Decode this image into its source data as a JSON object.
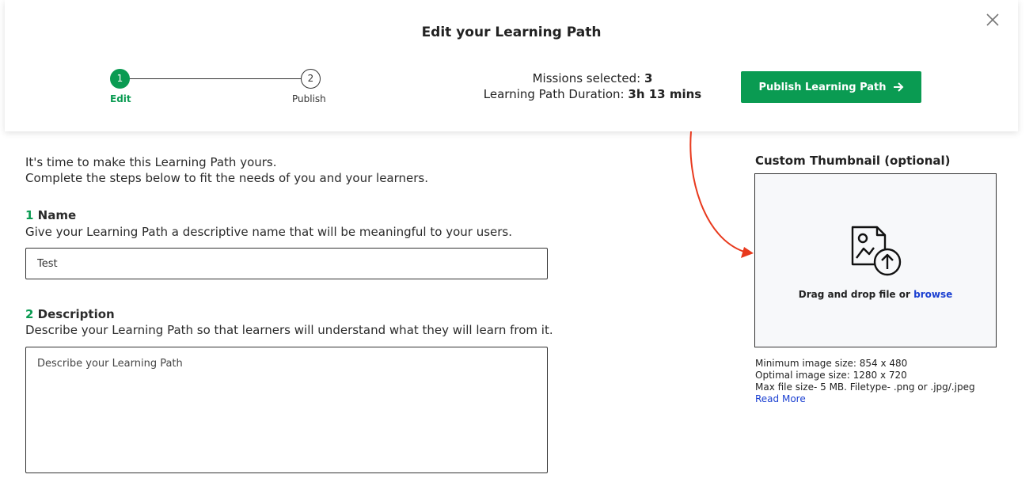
{
  "header": {
    "title": "Edit your Learning Path",
    "close_icon": "close-icon",
    "steps": [
      {
        "number": "1",
        "label": "Edit"
      },
      {
        "number": "2",
        "label": "Publish"
      }
    ],
    "missions_label": "Missions selected:",
    "missions_value": "3",
    "duration_label": "Learning Path Duration:",
    "duration_value": "3h 13 mins",
    "publish_button": "Publish Learning Path",
    "publish_icon": "arrow-right-icon"
  },
  "intro": {
    "line1": "It's time to make this Learning Path yours.",
    "line2": "Complete the steps below to fit the needs of you and your learners."
  },
  "name_section": {
    "number": "1",
    "heading": "Name",
    "description": "Give your Learning Path a descriptive name that will be meaningful to your users.",
    "value": "Test"
  },
  "description_section": {
    "number": "2",
    "heading": "Description",
    "description": "Describe your Learning Path so that learners will understand what they will learn from it.",
    "placeholder": "Describe your Learning Path"
  },
  "thumbnail": {
    "heading": "Custom Thumbnail (optional)",
    "upload_icon": "image-upload-icon",
    "drop_text": "Drag and drop file or",
    "browse": "browse",
    "min_size": "Minimum image size: 854 x 480",
    "optimal_size": "Optimal image size: 1280 x 720",
    "max_size": "Max file size- 5 MB. Filetype- .png or .jpg/.jpeg",
    "read_more": "Read More"
  },
  "colors": {
    "accent_green": "#0a9b52",
    "link_blue": "#1a3fd1",
    "annotation_red": "#e8391d"
  }
}
